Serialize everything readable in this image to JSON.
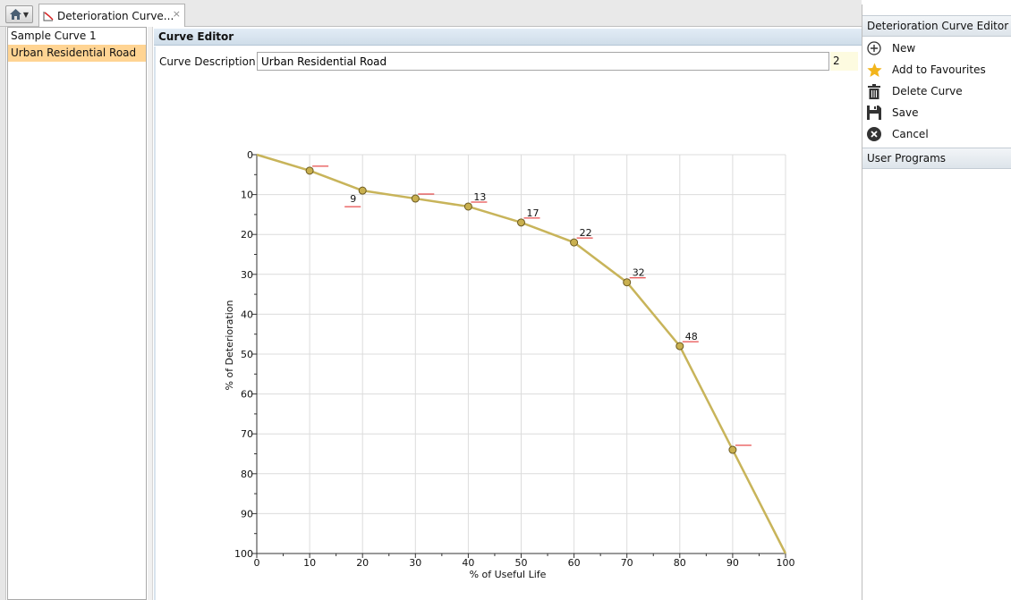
{
  "tabs": [
    {
      "label": "Deterioration Curve...",
      "close": "×"
    }
  ],
  "curve_list": {
    "items": [
      {
        "label": "Sample Curve 1",
        "selected": false
      },
      {
        "label": "Urban Residential Road",
        "selected": true
      }
    ]
  },
  "editor": {
    "header": "Curve Editor",
    "description_label": "Curve Description",
    "description_value": "Urban Residential Road",
    "description_count": "2"
  },
  "right_panel": {
    "header": "Deterioration Curve Editor",
    "actions": [
      {
        "label": "New",
        "icon": "add-circle-icon"
      },
      {
        "label": "Add to Favourites",
        "icon": "star-icon"
      },
      {
        "label": "Delete Curve",
        "icon": "trash-icon"
      },
      {
        "label": "Save",
        "icon": "floppy-disk-icon"
      },
      {
        "label": "Cancel",
        "icon": "cancel-circle-icon"
      }
    ],
    "section2_header": "User Programs"
  },
  "chart_data": {
    "type": "line",
    "xlabel": "% of Useful Life",
    "ylabel": "% of Deterioration",
    "xlim": [
      0,
      100
    ],
    "ylim": [
      0,
      100
    ],
    "y_inverted": true,
    "grid": true,
    "x_ticks": [
      0,
      10,
      20,
      30,
      40,
      50,
      60,
      70,
      80,
      90,
      100
    ],
    "y_ticks": [
      0,
      10,
      20,
      30,
      40,
      50,
      60,
      70,
      80,
      90,
      100
    ],
    "series": [
      {
        "x": [
          0,
          10,
          20,
          30,
          40,
          50,
          60,
          70,
          80,
          90,
          100
        ],
        "y": [
          0,
          4,
          9,
          11,
          13,
          17,
          22,
          32,
          48,
          74,
          100
        ],
        "color": "#c8b45a"
      }
    ],
    "points": [
      {
        "x": 10,
        "y": 4,
        "label": ""
      },
      {
        "x": 20,
        "y": 9,
        "label": "9"
      },
      {
        "x": 30,
        "y": 11,
        "label": ""
      },
      {
        "x": 40,
        "y": 13,
        "label": "13"
      },
      {
        "x": 50,
        "y": 17,
        "label": "17"
      },
      {
        "x": 60,
        "y": 22,
        "label": "22"
      },
      {
        "x": 70,
        "y": 32,
        "label": "32"
      },
      {
        "x": 80,
        "y": 48,
        "label": "48"
      },
      {
        "x": 90,
        "y": 74,
        "label": ""
      }
    ],
    "colors": {
      "line": "#c8b45a",
      "marker": "#c9b04f",
      "label_underline": "#e02020",
      "grid": "#dcdcdc"
    }
  }
}
